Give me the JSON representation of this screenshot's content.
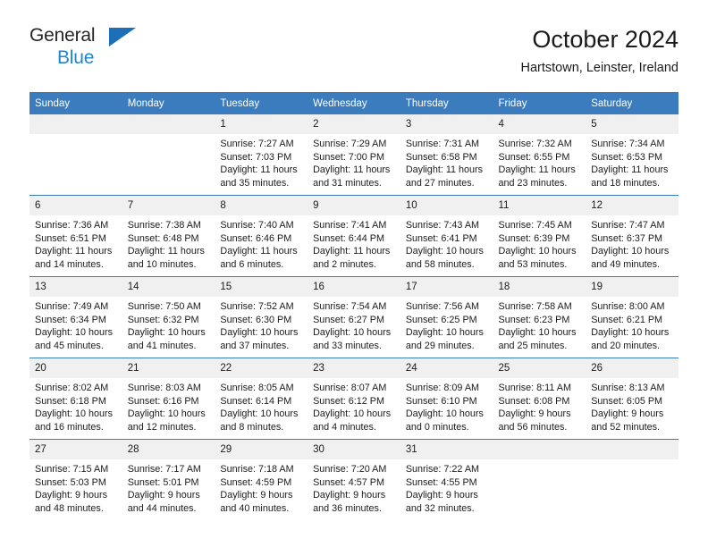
{
  "brand": {
    "word_one": "General",
    "word_two": "Blue",
    "triangle_color": "#1d70b8",
    "blue_color": "#1f86d0"
  },
  "header": {
    "title": "October 2024",
    "subtitle": "Hartstown, Leinster, Ireland",
    "header_bg": "#3a7cbe",
    "daynum_bg": "#f0f0f0"
  },
  "weekday_headers": [
    "Sunday",
    "Monday",
    "Tuesday",
    "Wednesday",
    "Thursday",
    "Friday",
    "Saturday"
  ],
  "weeks": [
    [
      {
        "day": "",
        "sunrise": "",
        "sunset": "",
        "daylight_line1": "",
        "daylight_line2": ""
      },
      {
        "day": "",
        "sunrise": "",
        "sunset": "",
        "daylight_line1": "",
        "daylight_line2": ""
      },
      {
        "day": "1",
        "sunrise": "Sunrise: 7:27 AM",
        "sunset": "Sunset: 7:03 PM",
        "daylight_line1": "Daylight: 11 hours",
        "daylight_line2": "and 35 minutes."
      },
      {
        "day": "2",
        "sunrise": "Sunrise: 7:29 AM",
        "sunset": "Sunset: 7:00 PM",
        "daylight_line1": "Daylight: 11 hours",
        "daylight_line2": "and 31 minutes."
      },
      {
        "day": "3",
        "sunrise": "Sunrise: 7:31 AM",
        "sunset": "Sunset: 6:58 PM",
        "daylight_line1": "Daylight: 11 hours",
        "daylight_line2": "and 27 minutes."
      },
      {
        "day": "4",
        "sunrise": "Sunrise: 7:32 AM",
        "sunset": "Sunset: 6:55 PM",
        "daylight_line1": "Daylight: 11 hours",
        "daylight_line2": "and 23 minutes."
      },
      {
        "day": "5",
        "sunrise": "Sunrise: 7:34 AM",
        "sunset": "Sunset: 6:53 PM",
        "daylight_line1": "Daylight: 11 hours",
        "daylight_line2": "and 18 minutes."
      }
    ],
    [
      {
        "day": "6",
        "sunrise": "Sunrise: 7:36 AM",
        "sunset": "Sunset: 6:51 PM",
        "daylight_line1": "Daylight: 11 hours",
        "daylight_line2": "and 14 minutes."
      },
      {
        "day": "7",
        "sunrise": "Sunrise: 7:38 AM",
        "sunset": "Sunset: 6:48 PM",
        "daylight_line1": "Daylight: 11 hours",
        "daylight_line2": "and 10 minutes."
      },
      {
        "day": "8",
        "sunrise": "Sunrise: 7:40 AM",
        "sunset": "Sunset: 6:46 PM",
        "daylight_line1": "Daylight: 11 hours",
        "daylight_line2": "and 6 minutes."
      },
      {
        "day": "9",
        "sunrise": "Sunrise: 7:41 AM",
        "sunset": "Sunset: 6:44 PM",
        "daylight_line1": "Daylight: 11 hours",
        "daylight_line2": "and 2 minutes."
      },
      {
        "day": "10",
        "sunrise": "Sunrise: 7:43 AM",
        "sunset": "Sunset: 6:41 PM",
        "daylight_line1": "Daylight: 10 hours",
        "daylight_line2": "and 58 minutes."
      },
      {
        "day": "11",
        "sunrise": "Sunrise: 7:45 AM",
        "sunset": "Sunset: 6:39 PM",
        "daylight_line1": "Daylight: 10 hours",
        "daylight_line2": "and 53 minutes."
      },
      {
        "day": "12",
        "sunrise": "Sunrise: 7:47 AM",
        "sunset": "Sunset: 6:37 PM",
        "daylight_line1": "Daylight: 10 hours",
        "daylight_line2": "and 49 minutes."
      }
    ],
    [
      {
        "day": "13",
        "sunrise": "Sunrise: 7:49 AM",
        "sunset": "Sunset: 6:34 PM",
        "daylight_line1": "Daylight: 10 hours",
        "daylight_line2": "and 45 minutes."
      },
      {
        "day": "14",
        "sunrise": "Sunrise: 7:50 AM",
        "sunset": "Sunset: 6:32 PM",
        "daylight_line1": "Daylight: 10 hours",
        "daylight_line2": "and 41 minutes."
      },
      {
        "day": "15",
        "sunrise": "Sunrise: 7:52 AM",
        "sunset": "Sunset: 6:30 PM",
        "daylight_line1": "Daylight: 10 hours",
        "daylight_line2": "and 37 minutes."
      },
      {
        "day": "16",
        "sunrise": "Sunrise: 7:54 AM",
        "sunset": "Sunset: 6:27 PM",
        "daylight_line1": "Daylight: 10 hours",
        "daylight_line2": "and 33 minutes."
      },
      {
        "day": "17",
        "sunrise": "Sunrise: 7:56 AM",
        "sunset": "Sunset: 6:25 PM",
        "daylight_line1": "Daylight: 10 hours",
        "daylight_line2": "and 29 minutes."
      },
      {
        "day": "18",
        "sunrise": "Sunrise: 7:58 AM",
        "sunset": "Sunset: 6:23 PM",
        "daylight_line1": "Daylight: 10 hours",
        "daylight_line2": "and 25 minutes."
      },
      {
        "day": "19",
        "sunrise": "Sunrise: 8:00 AM",
        "sunset": "Sunset: 6:21 PM",
        "daylight_line1": "Daylight: 10 hours",
        "daylight_line2": "and 20 minutes."
      }
    ],
    [
      {
        "day": "20",
        "sunrise": "Sunrise: 8:02 AM",
        "sunset": "Sunset: 6:18 PM",
        "daylight_line1": "Daylight: 10 hours",
        "daylight_line2": "and 16 minutes."
      },
      {
        "day": "21",
        "sunrise": "Sunrise: 8:03 AM",
        "sunset": "Sunset: 6:16 PM",
        "daylight_line1": "Daylight: 10 hours",
        "daylight_line2": "and 12 minutes."
      },
      {
        "day": "22",
        "sunrise": "Sunrise: 8:05 AM",
        "sunset": "Sunset: 6:14 PM",
        "daylight_line1": "Daylight: 10 hours",
        "daylight_line2": "and 8 minutes."
      },
      {
        "day": "23",
        "sunrise": "Sunrise: 8:07 AM",
        "sunset": "Sunset: 6:12 PM",
        "daylight_line1": "Daylight: 10 hours",
        "daylight_line2": "and 4 minutes."
      },
      {
        "day": "24",
        "sunrise": "Sunrise: 8:09 AM",
        "sunset": "Sunset: 6:10 PM",
        "daylight_line1": "Daylight: 10 hours",
        "daylight_line2": "and 0 minutes."
      },
      {
        "day": "25",
        "sunrise": "Sunrise: 8:11 AM",
        "sunset": "Sunset: 6:08 PM",
        "daylight_line1": "Daylight: 9 hours",
        "daylight_line2": "and 56 minutes."
      },
      {
        "day": "26",
        "sunrise": "Sunrise: 8:13 AM",
        "sunset": "Sunset: 6:05 PM",
        "daylight_line1": "Daylight: 9 hours",
        "daylight_line2": "and 52 minutes."
      }
    ],
    [
      {
        "day": "27",
        "sunrise": "Sunrise: 7:15 AM",
        "sunset": "Sunset: 5:03 PM",
        "daylight_line1": "Daylight: 9 hours",
        "daylight_line2": "and 48 minutes."
      },
      {
        "day": "28",
        "sunrise": "Sunrise: 7:17 AM",
        "sunset": "Sunset: 5:01 PM",
        "daylight_line1": "Daylight: 9 hours",
        "daylight_line2": "and 44 minutes."
      },
      {
        "day": "29",
        "sunrise": "Sunrise: 7:18 AM",
        "sunset": "Sunset: 4:59 PM",
        "daylight_line1": "Daylight: 9 hours",
        "daylight_line2": "and 40 minutes."
      },
      {
        "day": "30",
        "sunrise": "Sunrise: 7:20 AM",
        "sunset": "Sunset: 4:57 PM",
        "daylight_line1": "Daylight: 9 hours",
        "daylight_line2": "and 36 minutes."
      },
      {
        "day": "31",
        "sunrise": "Sunrise: 7:22 AM",
        "sunset": "Sunset: 4:55 PM",
        "daylight_line1": "Daylight: 9 hours",
        "daylight_line2": "and 32 minutes."
      },
      {
        "day": "",
        "sunrise": "",
        "sunset": "",
        "daylight_line1": "",
        "daylight_line2": ""
      },
      {
        "day": "",
        "sunrise": "",
        "sunset": "",
        "daylight_line1": "",
        "daylight_line2": ""
      }
    ]
  ]
}
